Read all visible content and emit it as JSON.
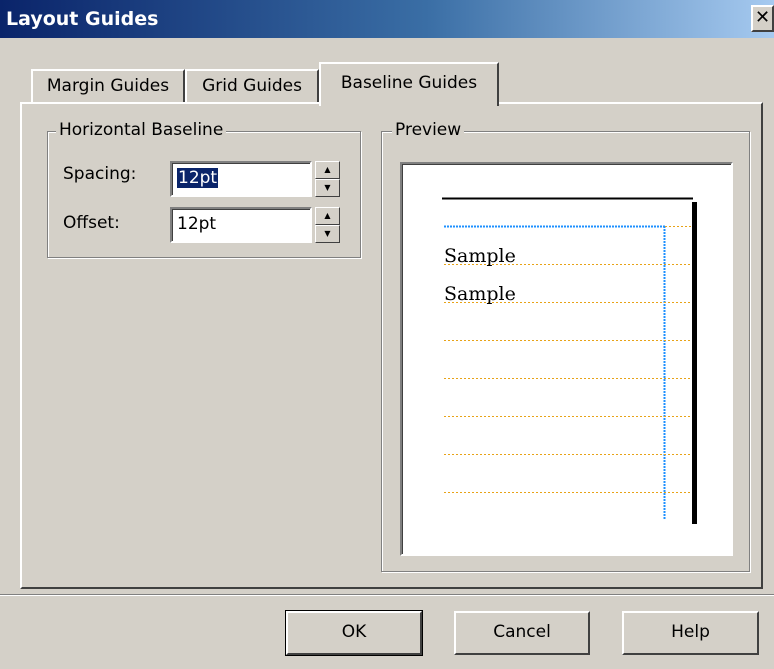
{
  "window": {
    "title": "Layout Guides",
    "close_glyph": "✕"
  },
  "tabs": [
    {
      "label": "Margin Guides",
      "active": false
    },
    {
      "label": "Grid Guides",
      "active": false
    },
    {
      "label": "Baseline Guides",
      "active": true
    }
  ],
  "horizontal_baseline": {
    "legend": "Horizontal Baseline",
    "spacing": {
      "label": "Spacing:",
      "value": "12pt"
    },
    "offset": {
      "label": "Offset:",
      "value": "12pt"
    }
  },
  "preview": {
    "legend": "Preview",
    "sample_lines": [
      "Sample",
      "Sample"
    ],
    "baseline_color": "#e8a317",
    "guide_color": "#1e90ff"
  },
  "buttons": {
    "ok": "OK",
    "cancel": "Cancel",
    "help": "Help"
  },
  "icons": {
    "close": "close-icon",
    "spin_up": "spin-up-icon",
    "spin_down": "spin-down-icon"
  }
}
